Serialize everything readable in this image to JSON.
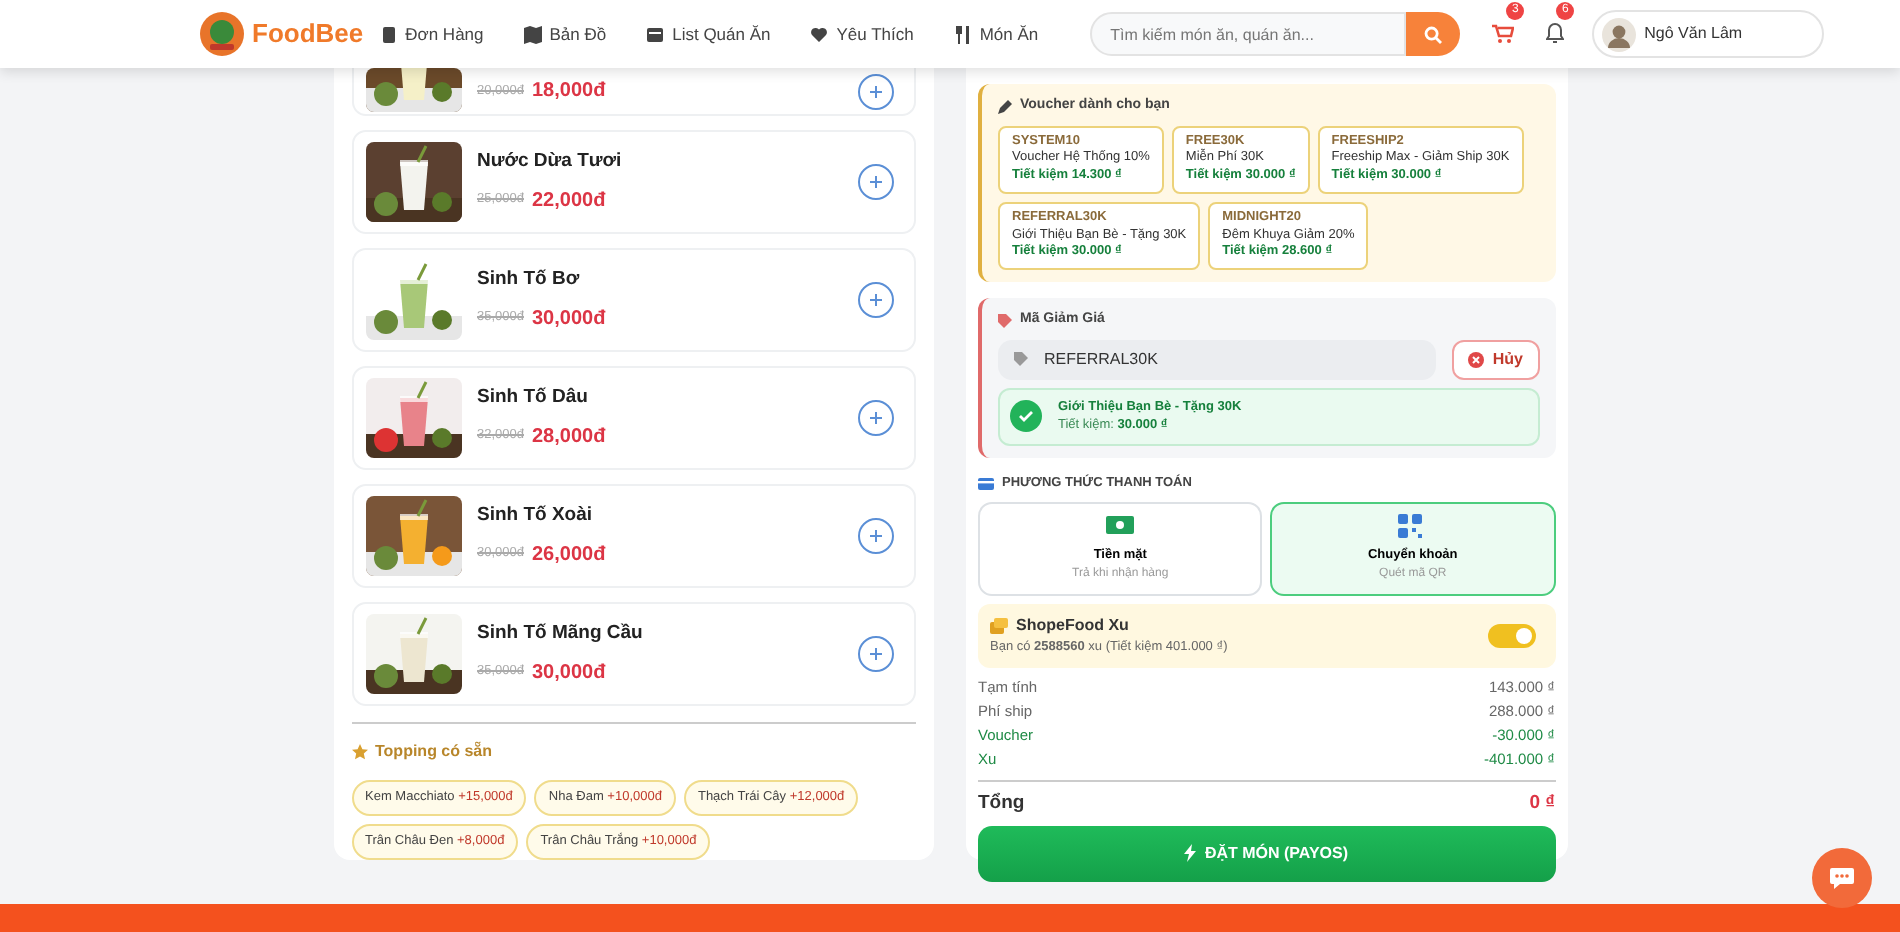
{
  "header": {
    "logo_text": "FoodBee",
    "nav": [
      {
        "label": "Đơn Hàng",
        "kind": "orders"
      },
      {
        "label": "Bản Đồ",
        "kind": "map"
      },
      {
        "label": "List Quán Ăn",
        "kind": "store"
      },
      {
        "label": "Yêu Thích",
        "kind": "heart"
      },
      {
        "label": "Món Ăn",
        "kind": "food"
      }
    ],
    "search": {
      "placeholder": "Tìm kiếm món ăn, quán ăn..."
    },
    "cart_badge": "3",
    "bell_badge": "6",
    "user_name": "Ngô Văn Lâm"
  },
  "products": [
    {
      "old_price": "20,000đ",
      "price": "18,000đ"
    },
    {
      "name": "Nước Dừa Tươi",
      "old_price": "25,000đ",
      "price": "22,000đ"
    },
    {
      "name": "Sinh Tố Bơ",
      "old_price": "35,000đ",
      "price": "30,000đ"
    },
    {
      "name": "Sinh Tố Dâu",
      "old_price": "32,000đ",
      "price": "28,000đ"
    },
    {
      "name": "Sinh Tố Xoài",
      "old_price": "30,000đ",
      "price": "26,000đ"
    },
    {
      "name": "Sinh Tố Mãng Cầu",
      "old_price": "35,000đ",
      "price": "30,000đ"
    }
  ],
  "toppings": {
    "title": "Topping có sẵn",
    "items": [
      {
        "name": "Kem Macchiato",
        "price": "+15,000đ"
      },
      {
        "name": "Nha Đam",
        "price": "+10,000đ"
      },
      {
        "name": "Thạch Trái Cây",
        "price": "+12,000đ"
      },
      {
        "name": "Trân Châu Đen",
        "price": "+8,000đ"
      },
      {
        "name": "Trân Châu Trắng",
        "price": "+10,000đ"
      }
    ]
  },
  "vouchers": {
    "title": "Voucher dành cho bạn",
    "items": [
      {
        "code": "SYSTEM10",
        "desc": "Voucher Hệ Thống 10%",
        "saving": "Tiết kiệm 14.300 ₫"
      },
      {
        "code": "FREE30K",
        "desc": "Miễn Phí 30K",
        "saving": "Tiết kiệm 30.000 ₫"
      },
      {
        "code": "FREESHIP2",
        "desc": "Freeship Max - Giảm Ship 30K",
        "saving": "Tiết kiệm 30.000 ₫"
      },
      {
        "code": "REFERRAL30K",
        "desc": "Giới Thiệu Bạn Bè - Tặng 30K",
        "saving": "Tiết kiệm 30.000 ₫"
      },
      {
        "code": "MIDNIGHT20",
        "desc": "Đêm Khuya Giảm 20%",
        "saving": "Tiết kiệm 28.600 ₫"
      }
    ]
  },
  "discount": {
    "title": "Mã Giảm Giá",
    "value": "REFERRAL30K",
    "cancel": "Hủy",
    "applied_title": "Giới Thiệu Bạn Bè - Tặng 30K",
    "applied_label": "Tiết kiệm:",
    "applied_amount": "30.000 ₫"
  },
  "payment": {
    "title": "PHƯƠNG THỨC THANH TOÁN",
    "methods": [
      {
        "kind": "cash",
        "label": "Tiền mặt",
        "sub": "Trả khi nhận hàng",
        "selected": false
      },
      {
        "kind": "qr",
        "label": "Chuyển khoản",
        "sub": "Quét mã QR",
        "selected": true
      }
    ]
  },
  "coins": {
    "title": "ShopeFood Xu",
    "text": "Bạn có **2588560** xu (Tiết kiệm 401.000 ₫)",
    "on": true
  },
  "summary": [
    {
      "label": "Tạm tính",
      "value": "143.000 ₫",
      "kind": "normal"
    },
    {
      "label": "Phí ship",
      "value": "288.000 ₫",
      "kind": "normal"
    },
    {
      "label": "Voucher",
      "value": "-30.000 ₫",
      "kind": "discount"
    },
    {
      "label": "Xu",
      "value": "-401.000 ₫",
      "kind": "discount"
    }
  ],
  "total": {
    "label": "Tổng",
    "value": "0 ₫"
  },
  "order_button": "ĐẶT MÓN (PAYOS)"
}
